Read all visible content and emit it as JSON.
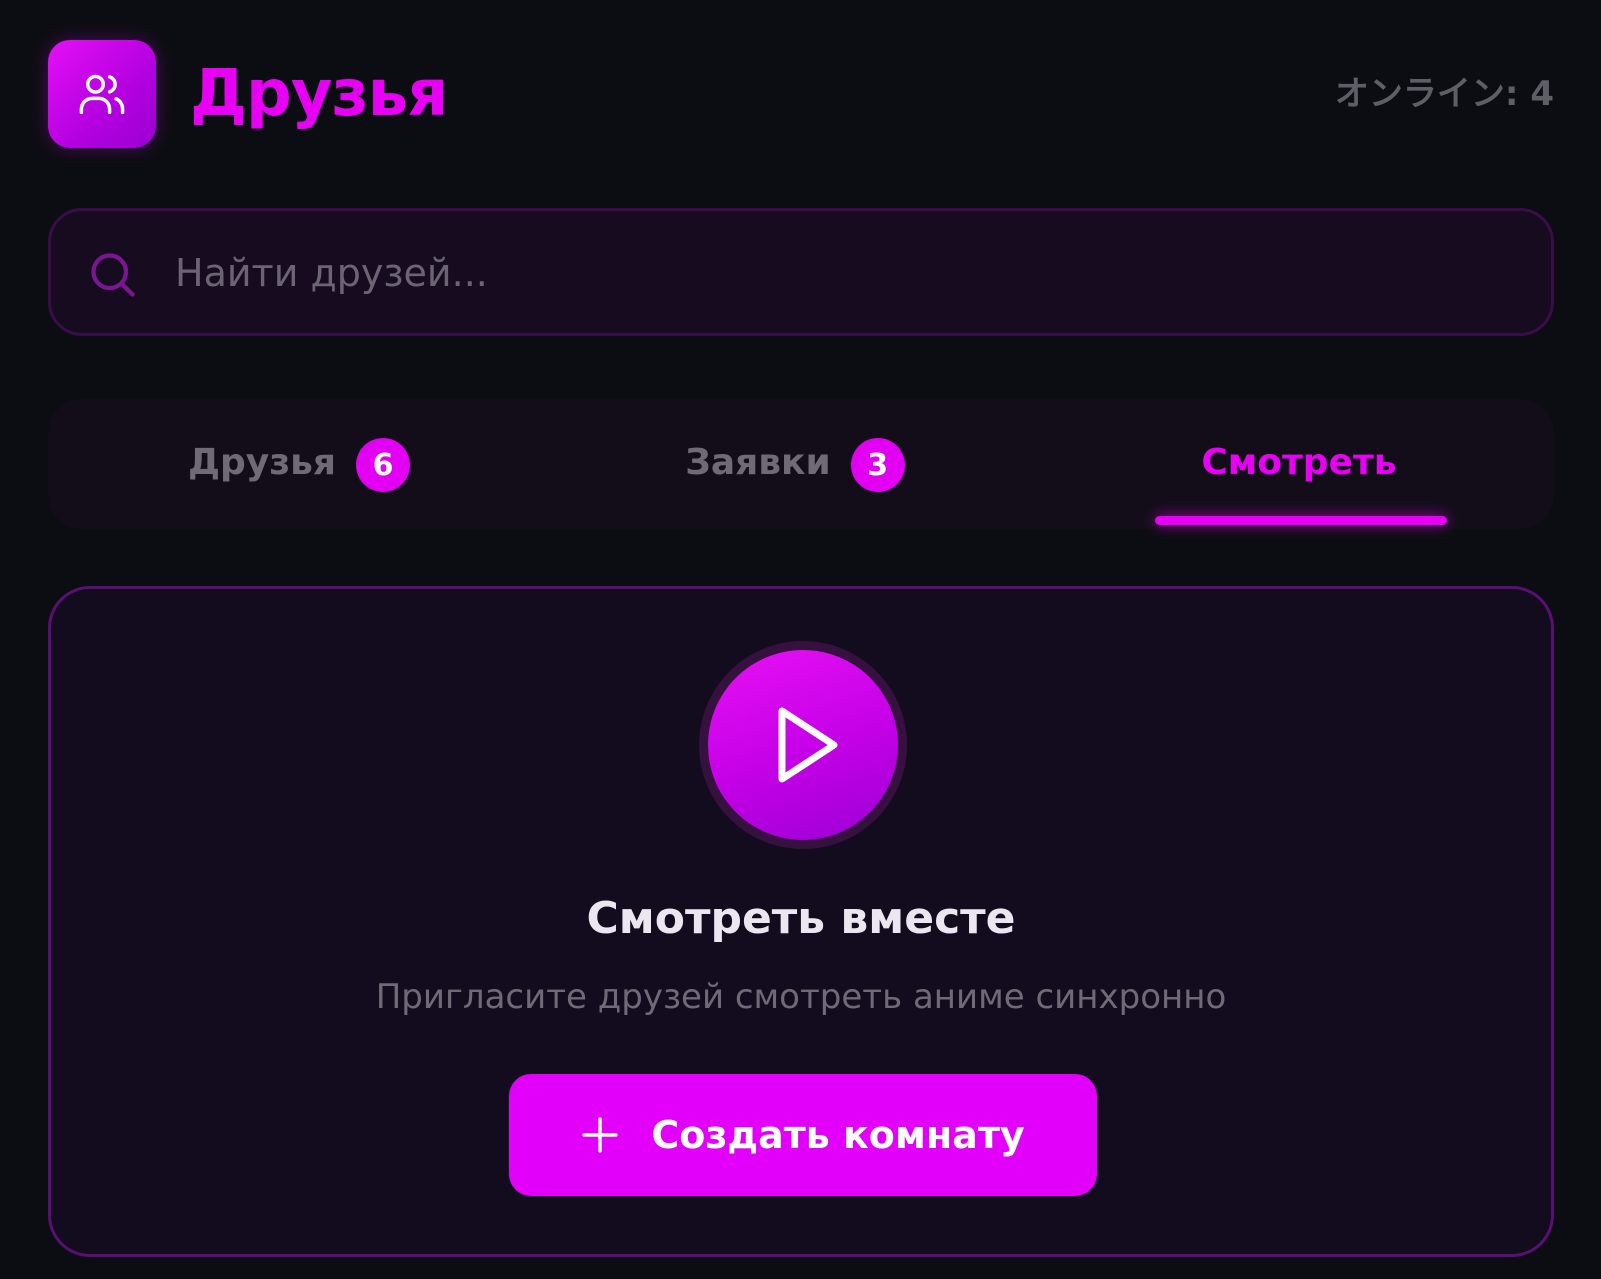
{
  "header": {
    "title": "Друзья",
    "icon": "users-icon",
    "online_text": "オンライン: 4"
  },
  "search": {
    "placeholder": "Найти друзей...",
    "value": "",
    "icon": "search-icon"
  },
  "tabs": [
    {
      "label": "Друзья",
      "badge": "6",
      "active": false
    },
    {
      "label": "Заявки",
      "badge": "3",
      "active": false
    },
    {
      "label": "Смотреть",
      "badge": null,
      "active": true
    }
  ],
  "watch": {
    "icon": "play-icon",
    "title": "Смотреть вместе",
    "subtitle": "Пригласите друзей смотреть аниме синхронно",
    "create_button": "Создать комнату",
    "create_icon": "plus-icon"
  },
  "colors": {
    "background": "#0c0d12",
    "accent": "#e800f5",
    "muted_text": "#6e6a76"
  }
}
